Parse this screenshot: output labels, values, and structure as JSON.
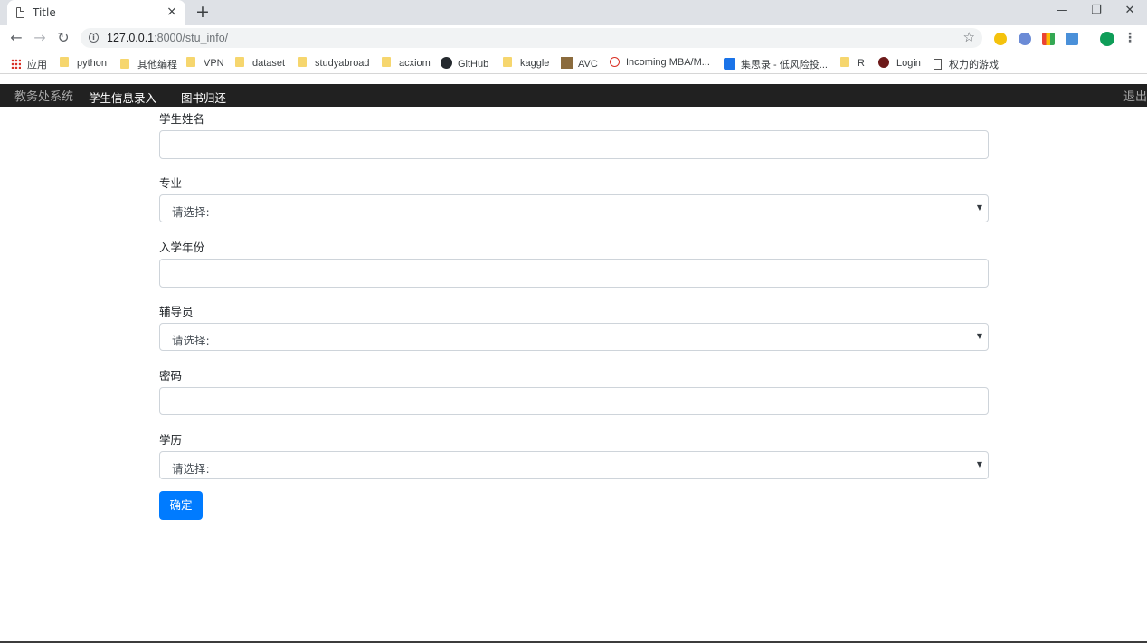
{
  "browser": {
    "tab_title": "Title",
    "tab_close": "×",
    "new_tab": "+",
    "window_minimize": "—",
    "window_restore": "❐",
    "window_close": "✕",
    "back": "←",
    "forward": "→",
    "reload": "↻",
    "url_host": "127.0.0.1",
    "url_rest": ":8000/stu_info/",
    "star": "☆",
    "menu": "⋮"
  },
  "bookmarks": [
    {
      "label": "应用",
      "icon": "apps-icon"
    },
    {
      "label": "python",
      "icon": "folder-icon"
    },
    {
      "label": "其他编程",
      "icon": "folder-icon"
    },
    {
      "label": "VPN",
      "icon": "folder-icon"
    },
    {
      "label": "dataset",
      "icon": "folder-icon"
    },
    {
      "label": "studyabroad",
      "icon": "folder-icon"
    },
    {
      "label": "acxiom",
      "icon": "folder-icon"
    },
    {
      "label": "GitHub",
      "icon": "github-icon"
    },
    {
      "label": "kaggle",
      "icon": "folder-icon"
    },
    {
      "label": "AVC",
      "icon": "avc-icon"
    },
    {
      "label": "Incoming MBA/M...",
      "icon": "mba-icon"
    },
    {
      "label": "集思录 - 低风险投...",
      "icon": "jisilu-icon"
    },
    {
      "label": "R",
      "icon": "folder-icon"
    },
    {
      "label": "Login",
      "icon": "login-icon"
    },
    {
      "label": "权力的游戏",
      "icon": "document-icon"
    }
  ],
  "app_nav": {
    "brand": "教务处系统",
    "links": [
      "学生信息录入",
      "图书归还"
    ],
    "logout": "退出"
  },
  "form": {
    "fields": [
      {
        "label": "学生姓名",
        "type": "text",
        "value": ""
      },
      {
        "label": "专业",
        "type": "select",
        "value": "请选择:"
      },
      {
        "label": "入学年份",
        "type": "text",
        "value": ""
      },
      {
        "label": "辅导员",
        "type": "select",
        "value": "请选择:"
      },
      {
        "label": "密码",
        "type": "password",
        "value": ""
      },
      {
        "label": "学历",
        "type": "select",
        "value": "请选择:"
      }
    ],
    "submit": "确定"
  },
  "colors": {
    "navbar_bg": "#212121",
    "primary_button": "#007bff",
    "folder": "#f6d66e"
  }
}
